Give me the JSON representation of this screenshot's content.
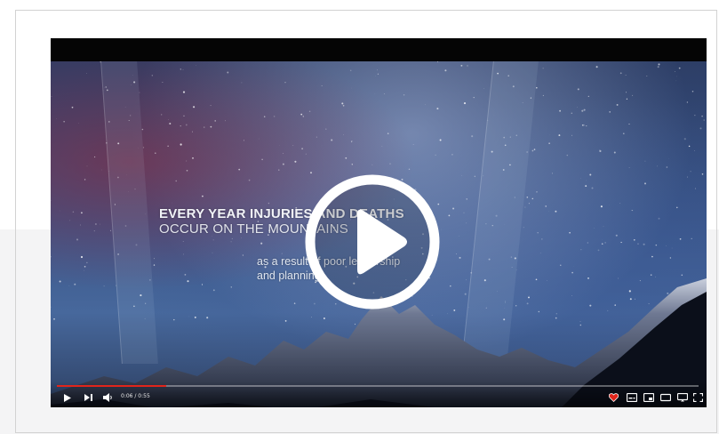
{
  "video": {
    "overlay_line1": "EVERY YEAR INJURIES AND DEATHS",
    "overlay_line2": "OCCUR ON THE MOUNTAINS",
    "overlay_line3": "as a result of poor leadership",
    "overlay_line4": "and planning."
  },
  "player": {
    "time_display": "0:06 / 0:55",
    "progress_fraction": 0.17,
    "accent_color": "#e1251b",
    "icons": {
      "big_play": "play-circle-icon",
      "play": "play-icon",
      "next": "skip-next-icon",
      "volume": "volume-icon",
      "watch_later": "heart-icon",
      "subtitles": "subtitles-icon",
      "settings": "settings-icon",
      "theater": "theater-icon",
      "cast": "cast-icon",
      "fullscreen": "fullscreen-icon"
    }
  }
}
